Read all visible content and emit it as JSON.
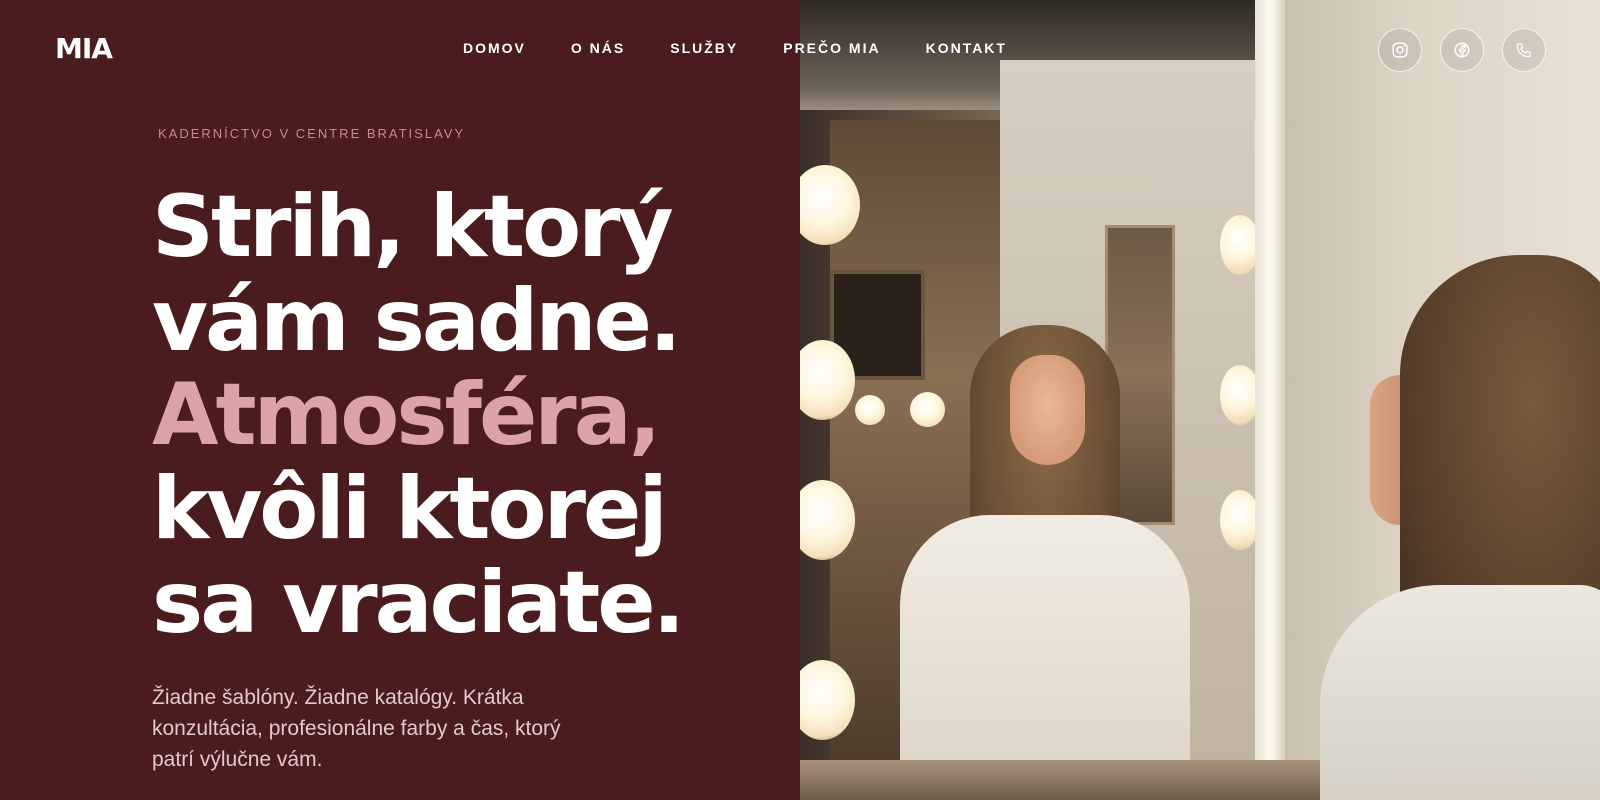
{
  "brand": {
    "logo": "MIA"
  },
  "nav": {
    "items": [
      {
        "label": "DOMOV"
      },
      {
        "label": "O NÁS"
      },
      {
        "label": "SLUŽBY"
      },
      {
        "label": "PREČO MIA"
      },
      {
        "label": "KONTAKT"
      }
    ]
  },
  "socials": [
    {
      "icon": "instagram-icon"
    },
    {
      "icon": "facebook-icon"
    },
    {
      "icon": "phone-icon"
    }
  ],
  "hero": {
    "eyebrow": "KADERNÍCTVO V CENTRE BRATISLAVY",
    "headline": {
      "line1": "Strih, ktorý",
      "line2": "vám sadne.",
      "line3": "Atmosféra,",
      "line4": "kvôli ktorej",
      "line5": "sa vraciate."
    },
    "lead": "Žiadne šablóny. Žiadne katalógy. Krátka konzultácia, profesionálne farby a čas, ktorý patrí výlučne vám."
  },
  "colors": {
    "background": "#4a1c1e",
    "accent": "#dba3a6",
    "eyebrow": "#c98b8f",
    "text": "#ffffff"
  }
}
